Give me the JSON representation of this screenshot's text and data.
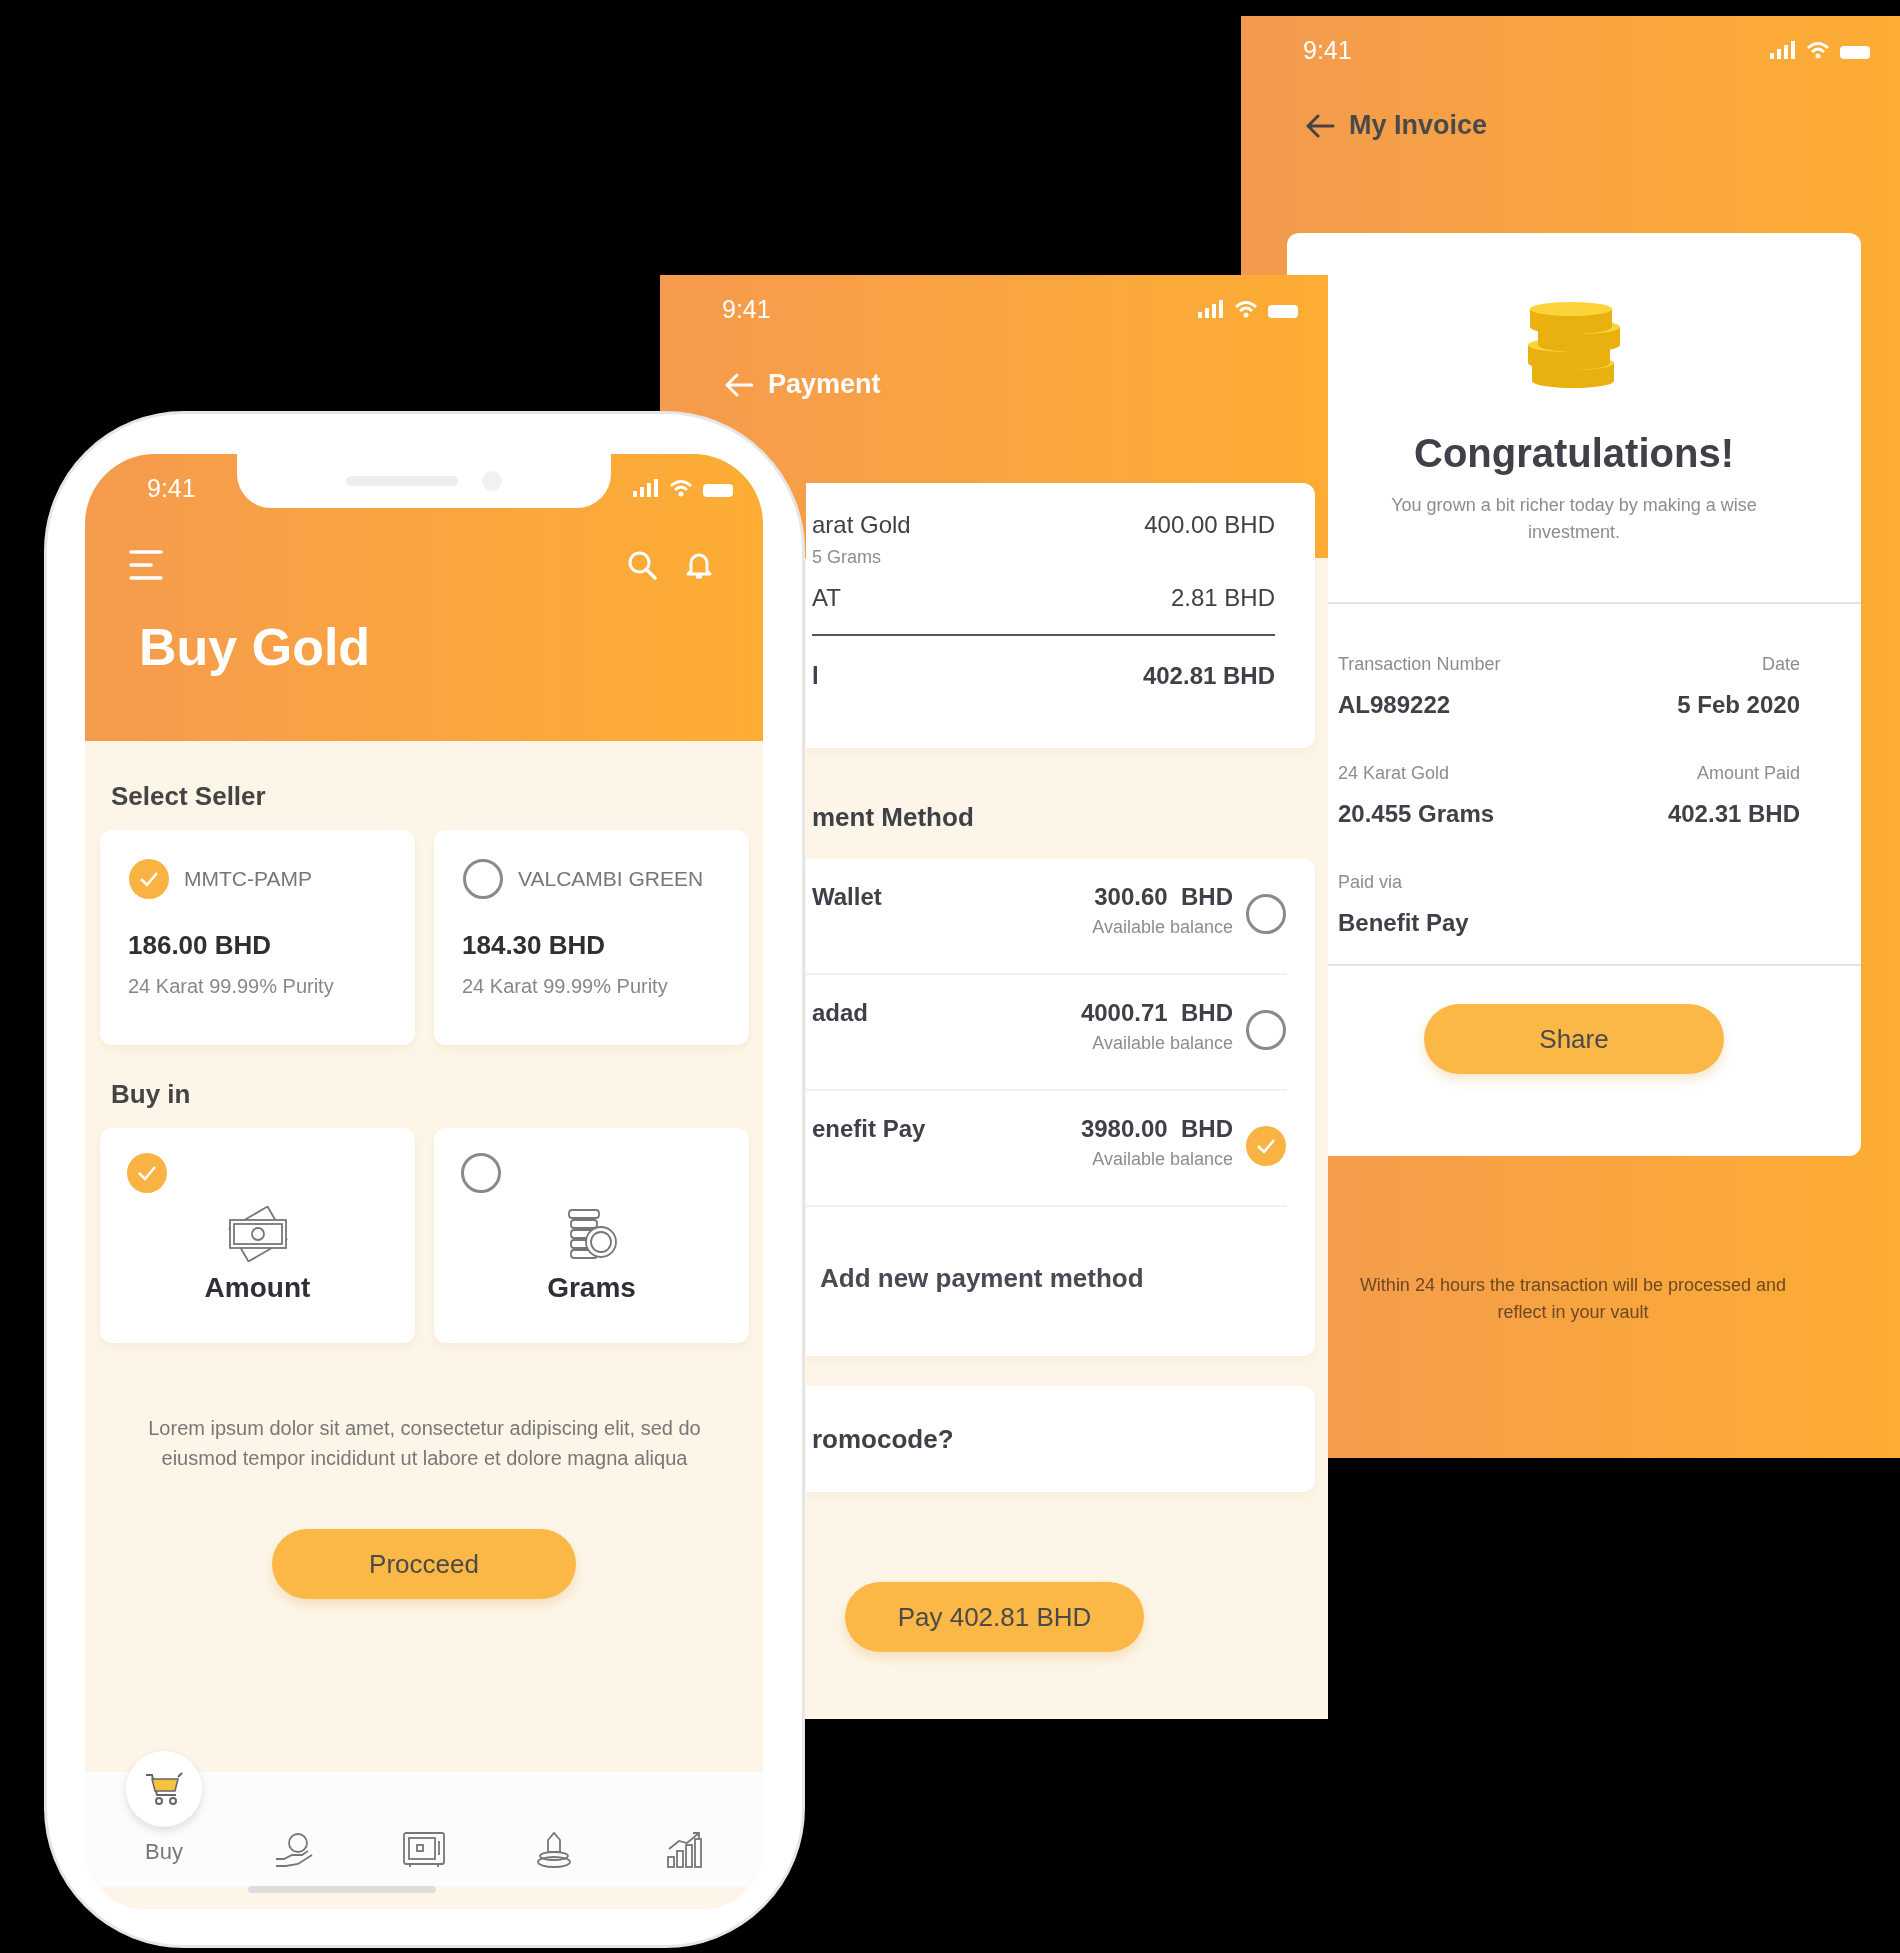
{
  "buy_gold_screen": {
    "status_bar": {
      "time": "9:41"
    },
    "title": "Buy Gold",
    "sellers_heading": "Select Seller",
    "sellers": [
      {
        "name": "MMTC-PAMP",
        "price": "186.00 BHD",
        "purity": "24 Karat 99.99% Purity",
        "selected": true
      },
      {
        "name": "VALCAMBI GREEN",
        "price": "184.30 BHD",
        "purity": "24 Karat 99.99% Purity",
        "selected": false
      }
    ],
    "buy_in_heading": "Buy in",
    "buy_options": [
      {
        "kind": "amount",
        "label": "Amount",
        "selected": true
      },
      {
        "kind": "grams",
        "label": "Grams",
        "selected": false
      }
    ],
    "description": "Lorem ipsum dolor sit amet, consectetur adipiscing elit, sed do eiusmod tempor incididunt ut labore et dolore magna aliqua",
    "proceed_button": "Procceed",
    "bottom_nav": [
      {
        "kind": "cart",
        "label": "Buy",
        "selected": true
      },
      {
        "kind": "hand-coin",
        "selected": false
      },
      {
        "kind": "safe",
        "selected": false
      },
      {
        "kind": "gold-bars",
        "selected": false
      },
      {
        "kind": "chart",
        "selected": false
      }
    ]
  },
  "payment_screen": {
    "status_bar": {
      "time": "9:41"
    },
    "title": "Payment",
    "summary": [
      {
        "kind": "item",
        "label": "arat Gold",
        "detail": "5 Grams",
        "amount": "400.00 BHD"
      },
      {
        "kind": "item",
        "label": "AT",
        "amount": "2.81 BHD"
      },
      {
        "kind": "total",
        "label": "l",
        "amount": "402.81 BHD"
      }
    ],
    "methods_heading": "ment Method",
    "methods": [
      {
        "name": "Wallet",
        "balance": "300.60  BHD",
        "balance_note": "Available balance",
        "selected": false
      },
      {
        "name": "adad",
        "balance": "4000.71  BHD",
        "balance_note": "Available balance",
        "selected": false
      },
      {
        "name": "enefit Pay",
        "balance": "3980.00  BHD",
        "balance_note": "Available balance",
        "selected": true
      }
    ],
    "add_method": "Add new payment method",
    "promocode": "romocode?",
    "pay_button": "Pay 402.81 BHD"
  },
  "invoice_screen": {
    "status_bar": {
      "time": "9:41"
    },
    "title": "My Invoice",
    "heading": "Congratulations!",
    "message": "You grown a bit richer today by making a wise investment.",
    "details": [
      [
        {
          "label": "Transaction Number",
          "value": "AL989222"
        },
        {
          "label": "Date",
          "value": "5 Feb 2020"
        }
      ],
      [
        {
          "label": "24 Karat Gold",
          "value": "20.455 Grams"
        },
        {
          "label": "Amount Paid",
          "value": "402.31 BHD"
        }
      ],
      [
        {
          "label": "Paid via",
          "value": "Benefit Pay"
        }
      ]
    ],
    "share_button": "Share",
    "note": "Within 24 hours the transaction will be processed and reflect in your vault"
  }
}
